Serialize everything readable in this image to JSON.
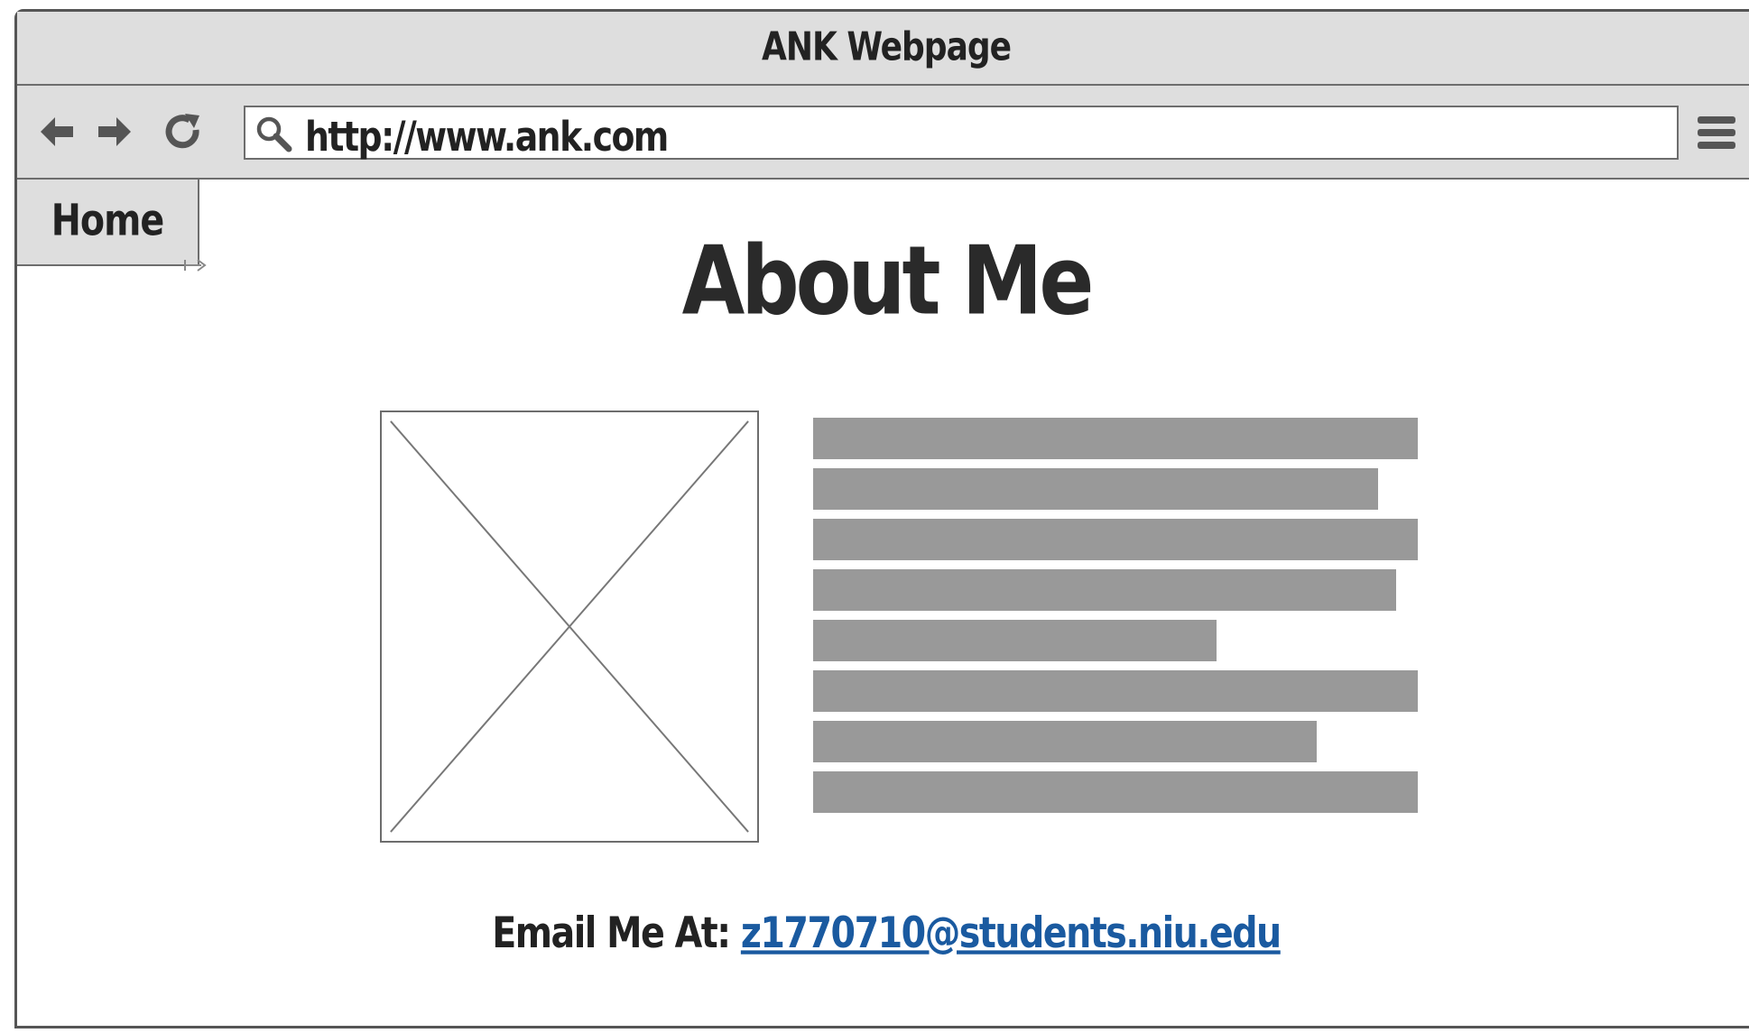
{
  "window": {
    "title": "ANK Webpage"
  },
  "nav": {
    "back_icon": "arrow-left-icon",
    "forward_icon": "arrow-right-icon",
    "reload_icon": "reload-icon",
    "menu_icon": "hamburger-menu-icon"
  },
  "address_bar": {
    "search_icon": "search-icon",
    "url": "http://www.ank.com"
  },
  "tabs": {
    "home_label": "Home"
  },
  "main": {
    "heading": "About Me",
    "image_placeholder": "image-placeholder-icon",
    "email_label": "Email Me At:",
    "email_address": "z1770710@students.niu.edu"
  },
  "colors": {
    "chrome_background": "#dedede",
    "chrome_border": "#6d6d6d",
    "text_placeholder": "#999999",
    "link": "#1a5aa0",
    "text": "#222222"
  }
}
